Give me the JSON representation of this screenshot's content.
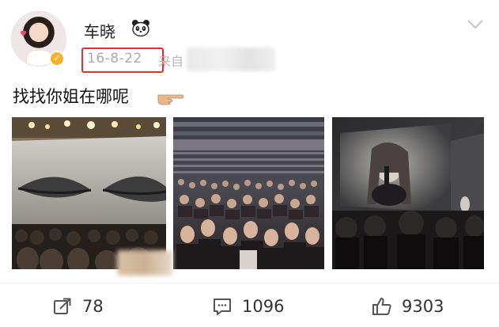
{
  "user": {
    "name": "车晓",
    "avatar_icon": "user-avatar",
    "verified_icon": "verified-badge-icon",
    "name_emoji_icon": "panda-icon"
  },
  "meta": {
    "timestamp": "16-8-22",
    "source_prefix": "来自",
    "highlight_color": "#e0332b"
  },
  "post": {
    "text": "找找你姐在哪呢",
    "trailing_emoji_icon": "pointing-hand-icon",
    "images": [
      "concert-stage-photo",
      "arena-crowd-photo",
      "singer-on-screen-photo"
    ]
  },
  "actions": {
    "repost": {
      "icon": "repost-icon",
      "count": "78"
    },
    "comment": {
      "icon": "comment-icon",
      "count": "1096"
    },
    "like": {
      "icon": "thumbs-up-icon",
      "count": "9303"
    }
  },
  "menu": {
    "icon": "chevron-down-icon"
  }
}
